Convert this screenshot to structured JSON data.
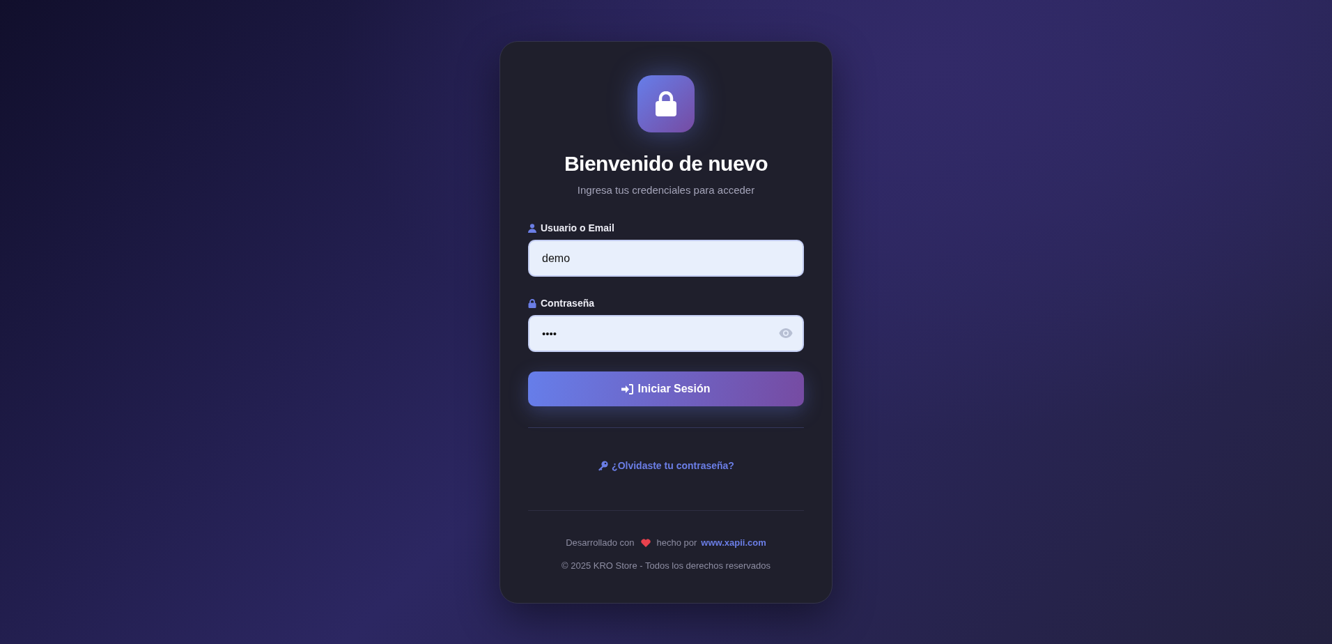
{
  "card": {
    "title": "Bienvenido de nuevo",
    "subtitle": "Ingresa tus credenciales para acceder"
  },
  "fields": [
    {
      "kind": "user",
      "label": "Usuario o Email",
      "value": "demo"
    },
    {
      "kind": "password",
      "label": "Contraseña",
      "value": "••••"
    }
  ],
  "submit_button": {
    "label": "Iniciar Sesión"
  },
  "forgot_link": {
    "label": "¿Olvidaste tu contraseña?"
  },
  "footer": {
    "made_with": "Desarrollado con",
    "made_by": "hecho por",
    "link": "www.xapii.com",
    "copyright": "© 2025 KRO Store - Todos los derechos reservados"
  }
}
